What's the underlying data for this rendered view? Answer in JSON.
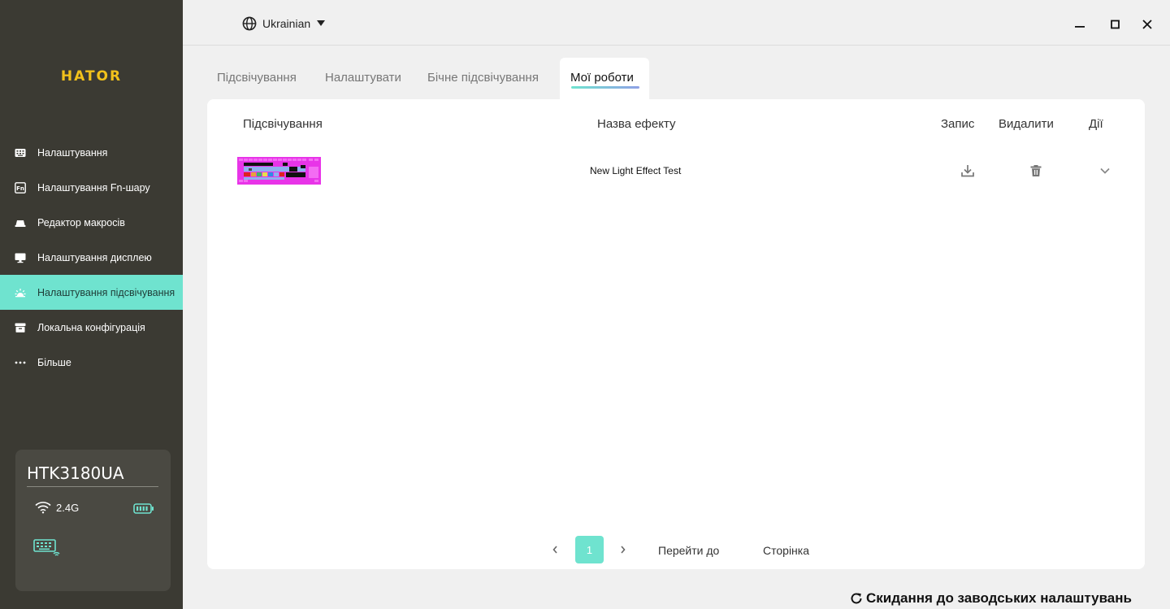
{
  "app": {
    "brand": "HATOR"
  },
  "sidebar": {
    "items": [
      {
        "label": "Налаштування",
        "icon": "keyboard-icon"
      },
      {
        "label": "Налаштування Fn-шару",
        "icon": "fn-key-icon"
      },
      {
        "label": "Редактор макросів",
        "icon": "macro-icon"
      },
      {
        "label": "Налаштування дисплею",
        "icon": "monitor-icon"
      },
      {
        "label": "Налаштування підсвічування",
        "icon": "sun-light-icon",
        "active": true
      },
      {
        "label": "Локальна конфігурація",
        "icon": "archive-icon"
      },
      {
        "label": "Більше",
        "icon": "more-dots-icon"
      }
    ]
  },
  "device": {
    "name": "HTK3180UA",
    "connection": "2.4G",
    "connection_icon": "wifi-icon",
    "battery_icon": "battery-full-icon",
    "keyboard_icon": "wireless-keyboard-icon"
  },
  "header": {
    "language": "Ukrainian",
    "window_controls": [
      "minimize-icon",
      "maximize-icon",
      "close-icon"
    ]
  },
  "tabs": [
    {
      "label": "Підсвічування"
    },
    {
      "label": "Налаштувати"
    },
    {
      "label": "Бічне підсвічування"
    },
    {
      "label": "Мої роботи",
      "active": true
    }
  ],
  "table": {
    "columns": [
      "Підсвічування",
      "Назва ефекту",
      "Запис",
      "Видалити",
      "Дії"
    ],
    "rows": [
      {
        "effect_name": "New Light Effect Test"
      }
    ]
  },
  "pagination": {
    "current_page": "1",
    "goto_label": "Перейти до",
    "page_label": "Сторінка"
  },
  "footer": {
    "reset_label": "Скидання до заводських налаштувань"
  },
  "colors": {
    "accent": "#6fe3cf",
    "sidebar_bg": "#3b3a33",
    "brand": "#f2c21b"
  }
}
